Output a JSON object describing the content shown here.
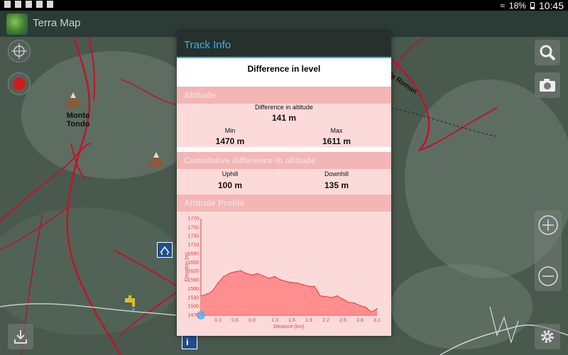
{
  "status_bar": {
    "battery": "18%",
    "time": "10:45"
  },
  "app": {
    "title": "Terra Map"
  },
  "map": {
    "labels": [
      "Monte",
      "Tondo"
    ],
    "road_label": "ta Roman"
  },
  "dialog": {
    "title": "Track Info",
    "subtitle": "Difference in level",
    "altitude": {
      "header": "Altitude",
      "difference_label": "Difference in altitude",
      "difference_value": "141 m",
      "min_label": "Min",
      "min_value": "1470 m",
      "max_label": "Max",
      "max_value": "1611 m"
    },
    "cumulative": {
      "header": "Cumulative difference in altitude",
      "uphill_label": "Uphill",
      "uphill_value": "100 m",
      "downhill_label": "Downhill",
      "downhill_value": "135 m"
    },
    "profile": {
      "header": "Altitude Profile"
    }
  },
  "chart_data": {
    "type": "area",
    "xlabel": "Distance (km)",
    "ylabel": "Elevation (m)",
    "x_ticks": [
      "0.3",
      "0.6",
      "0.9",
      "1.3",
      "1.6",
      "1.9",
      "2.2",
      "2.5",
      "2.8",
      "3.1"
    ],
    "y_ticks": [
      "1770",
      "1750",
      "1730",
      "1710",
      "1680",
      "1650",
      "1620",
      "1590",
      "1560",
      "1530",
      "1500",
      "1470"
    ],
    "xlim": [
      0,
      3.1
    ],
    "ylim": [
      1470,
      1770
    ],
    "x": [
      0.0,
      0.1,
      0.2,
      0.3,
      0.4,
      0.5,
      0.6,
      0.7,
      0.8,
      0.9,
      1.0,
      1.1,
      1.2,
      1.3,
      1.4,
      1.5,
      1.6,
      1.7,
      1.8,
      1.9,
      2.0,
      2.1,
      2.2,
      2.3,
      2.4,
      2.5,
      2.6,
      2.7,
      2.8,
      2.9,
      3.0,
      3.1
    ],
    "values": [
      1530,
      1535,
      1545,
      1570,
      1590,
      1600,
      1605,
      1608,
      1600,
      1595,
      1600,
      1592,
      1585,
      1590,
      1580,
      1575,
      1572,
      1570,
      1565,
      1560,
      1560,
      1530,
      1528,
      1525,
      1530,
      1520,
      1510,
      1508,
      1500,
      1495,
      1480,
      1490
    ],
    "fill_color": "#ff8080",
    "line_color": "#e83a3a"
  }
}
